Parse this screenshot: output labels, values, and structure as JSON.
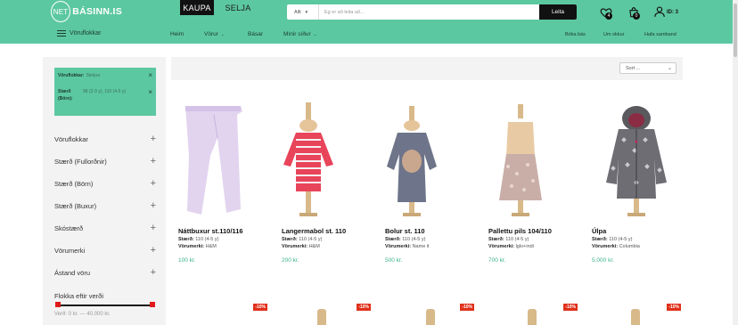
{
  "header": {
    "logo_net": "NET",
    "logo_text": "BÁSINN.IS",
    "tab_buy": "KAUPA",
    "tab_sell": "SELJA",
    "search": {
      "category": "Allt",
      "placeholder": "Ég er að leita að...",
      "button": "Leita"
    },
    "wishlist_count": "4",
    "cart_count": "0",
    "user_id": "ID: 3"
  },
  "nav": {
    "categories_label": "Vöruflokkar",
    "items": [
      "Heim",
      "Vörur",
      "Básar",
      "Mínir síður"
    ],
    "right_links": [
      "Bóka bás",
      "Um okkur",
      "Hafa samband"
    ]
  },
  "sidebar": {
    "active_filters": [
      {
        "key": "Vöruflokkar:",
        "value": "Stelpur"
      },
      {
        "key": "Stærð (Börn):",
        "value": "98 (2-3 y), 110 (4-5 y)"
      }
    ],
    "accordion": [
      "Vöruflokkar",
      "Stærð (Fullorðnir)",
      "Stærð (Börn)",
      "Stærð (Buxur)",
      "Skóstærð",
      "Vörumerki",
      "Ástand vöru"
    ],
    "price_label": "Flokka eftir verði",
    "price_range": "Verð: 0 kr. — 40.000 kr.",
    "slider_fill": 1.0
  },
  "main": {
    "sort_label": "Sort ...",
    "size_label": "Stærð:",
    "brand_label": "Vörumerki:",
    "products": [
      {
        "name": "Náttbuxur st.110/116",
        "size": "110 (4-5 y)",
        "brand": "H&M",
        "price": "100 kr."
      },
      {
        "name": "Langermabol st. 110",
        "size": "110 (4-5 y)",
        "brand": "H&M",
        "price": "200 kr."
      },
      {
        "name": "Bolur st. 110",
        "size": "110 (4-5 y)",
        "brand": "Name it",
        "price": "500 kr."
      },
      {
        "name": "Pallettu pils 104/110",
        "size": "110 (4-5 y)",
        "brand": "lglo+indi",
        "price": "700 kr."
      },
      {
        "name": "Úlpa",
        "size": "110 (4-5 y)",
        "brand": "Columbia",
        "price": "5.000 kr."
      }
    ],
    "discount_badge": "-10%"
  },
  "colors": {
    "accent": "#5cc8a2",
    "price": "#3cb38a",
    "discount": "#e0301a"
  }
}
